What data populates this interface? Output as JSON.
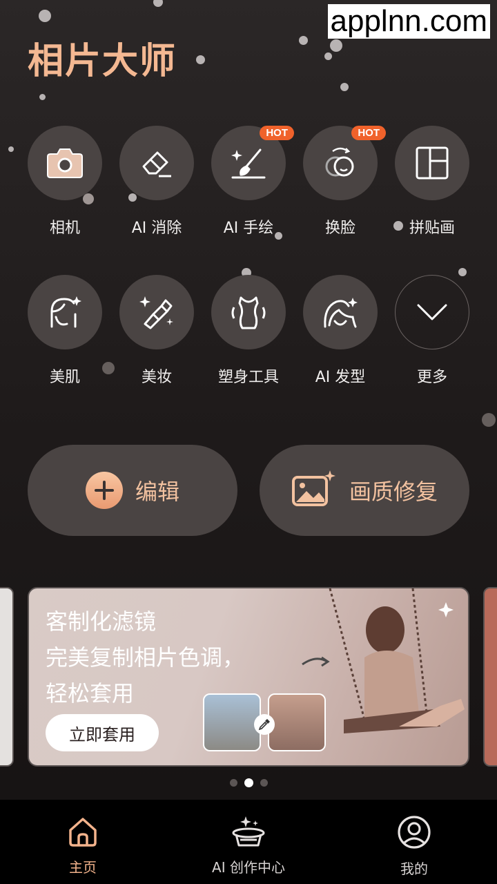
{
  "watermark": "applnn.com",
  "app": {
    "title": "相片大师"
  },
  "tools_row1": [
    {
      "label": "相机",
      "icon": "camera-icon",
      "badge": ""
    },
    {
      "label": "AI 消除",
      "icon": "eraser-icon",
      "badge": ""
    },
    {
      "label": "AI 手绘",
      "icon": "brush-icon",
      "badge": "HOT"
    },
    {
      "label": "换脸",
      "icon": "face-swap-icon",
      "badge": "HOT"
    },
    {
      "label": "拼贴画",
      "icon": "collage-icon",
      "badge": ""
    }
  ],
  "tools_row2": [
    {
      "label": "美肌",
      "icon": "skin-icon"
    },
    {
      "label": "美妆",
      "icon": "makeup-icon"
    },
    {
      "label": "塑身工具",
      "icon": "body-icon"
    },
    {
      "label": "AI 发型",
      "icon": "hairstyle-icon"
    },
    {
      "label": "更多",
      "icon": "chevron-down-icon"
    }
  ],
  "actions": {
    "edit_label": "编辑",
    "repair_label": "画质修复"
  },
  "banner": {
    "line1": "客制化滤镜",
    "line2": "完美复制相片色调，",
    "line3": "轻松套用",
    "cta": "立即套用"
  },
  "pager": {
    "count": 3,
    "active_index": 1
  },
  "tabbar": {
    "home": "主页",
    "ai_center": "AI 创作中心",
    "mine": "我的"
  },
  "colors": {
    "accent": "#f4b892",
    "hot_badge": "#f0622b",
    "circle_bg": "#4a4443"
  }
}
